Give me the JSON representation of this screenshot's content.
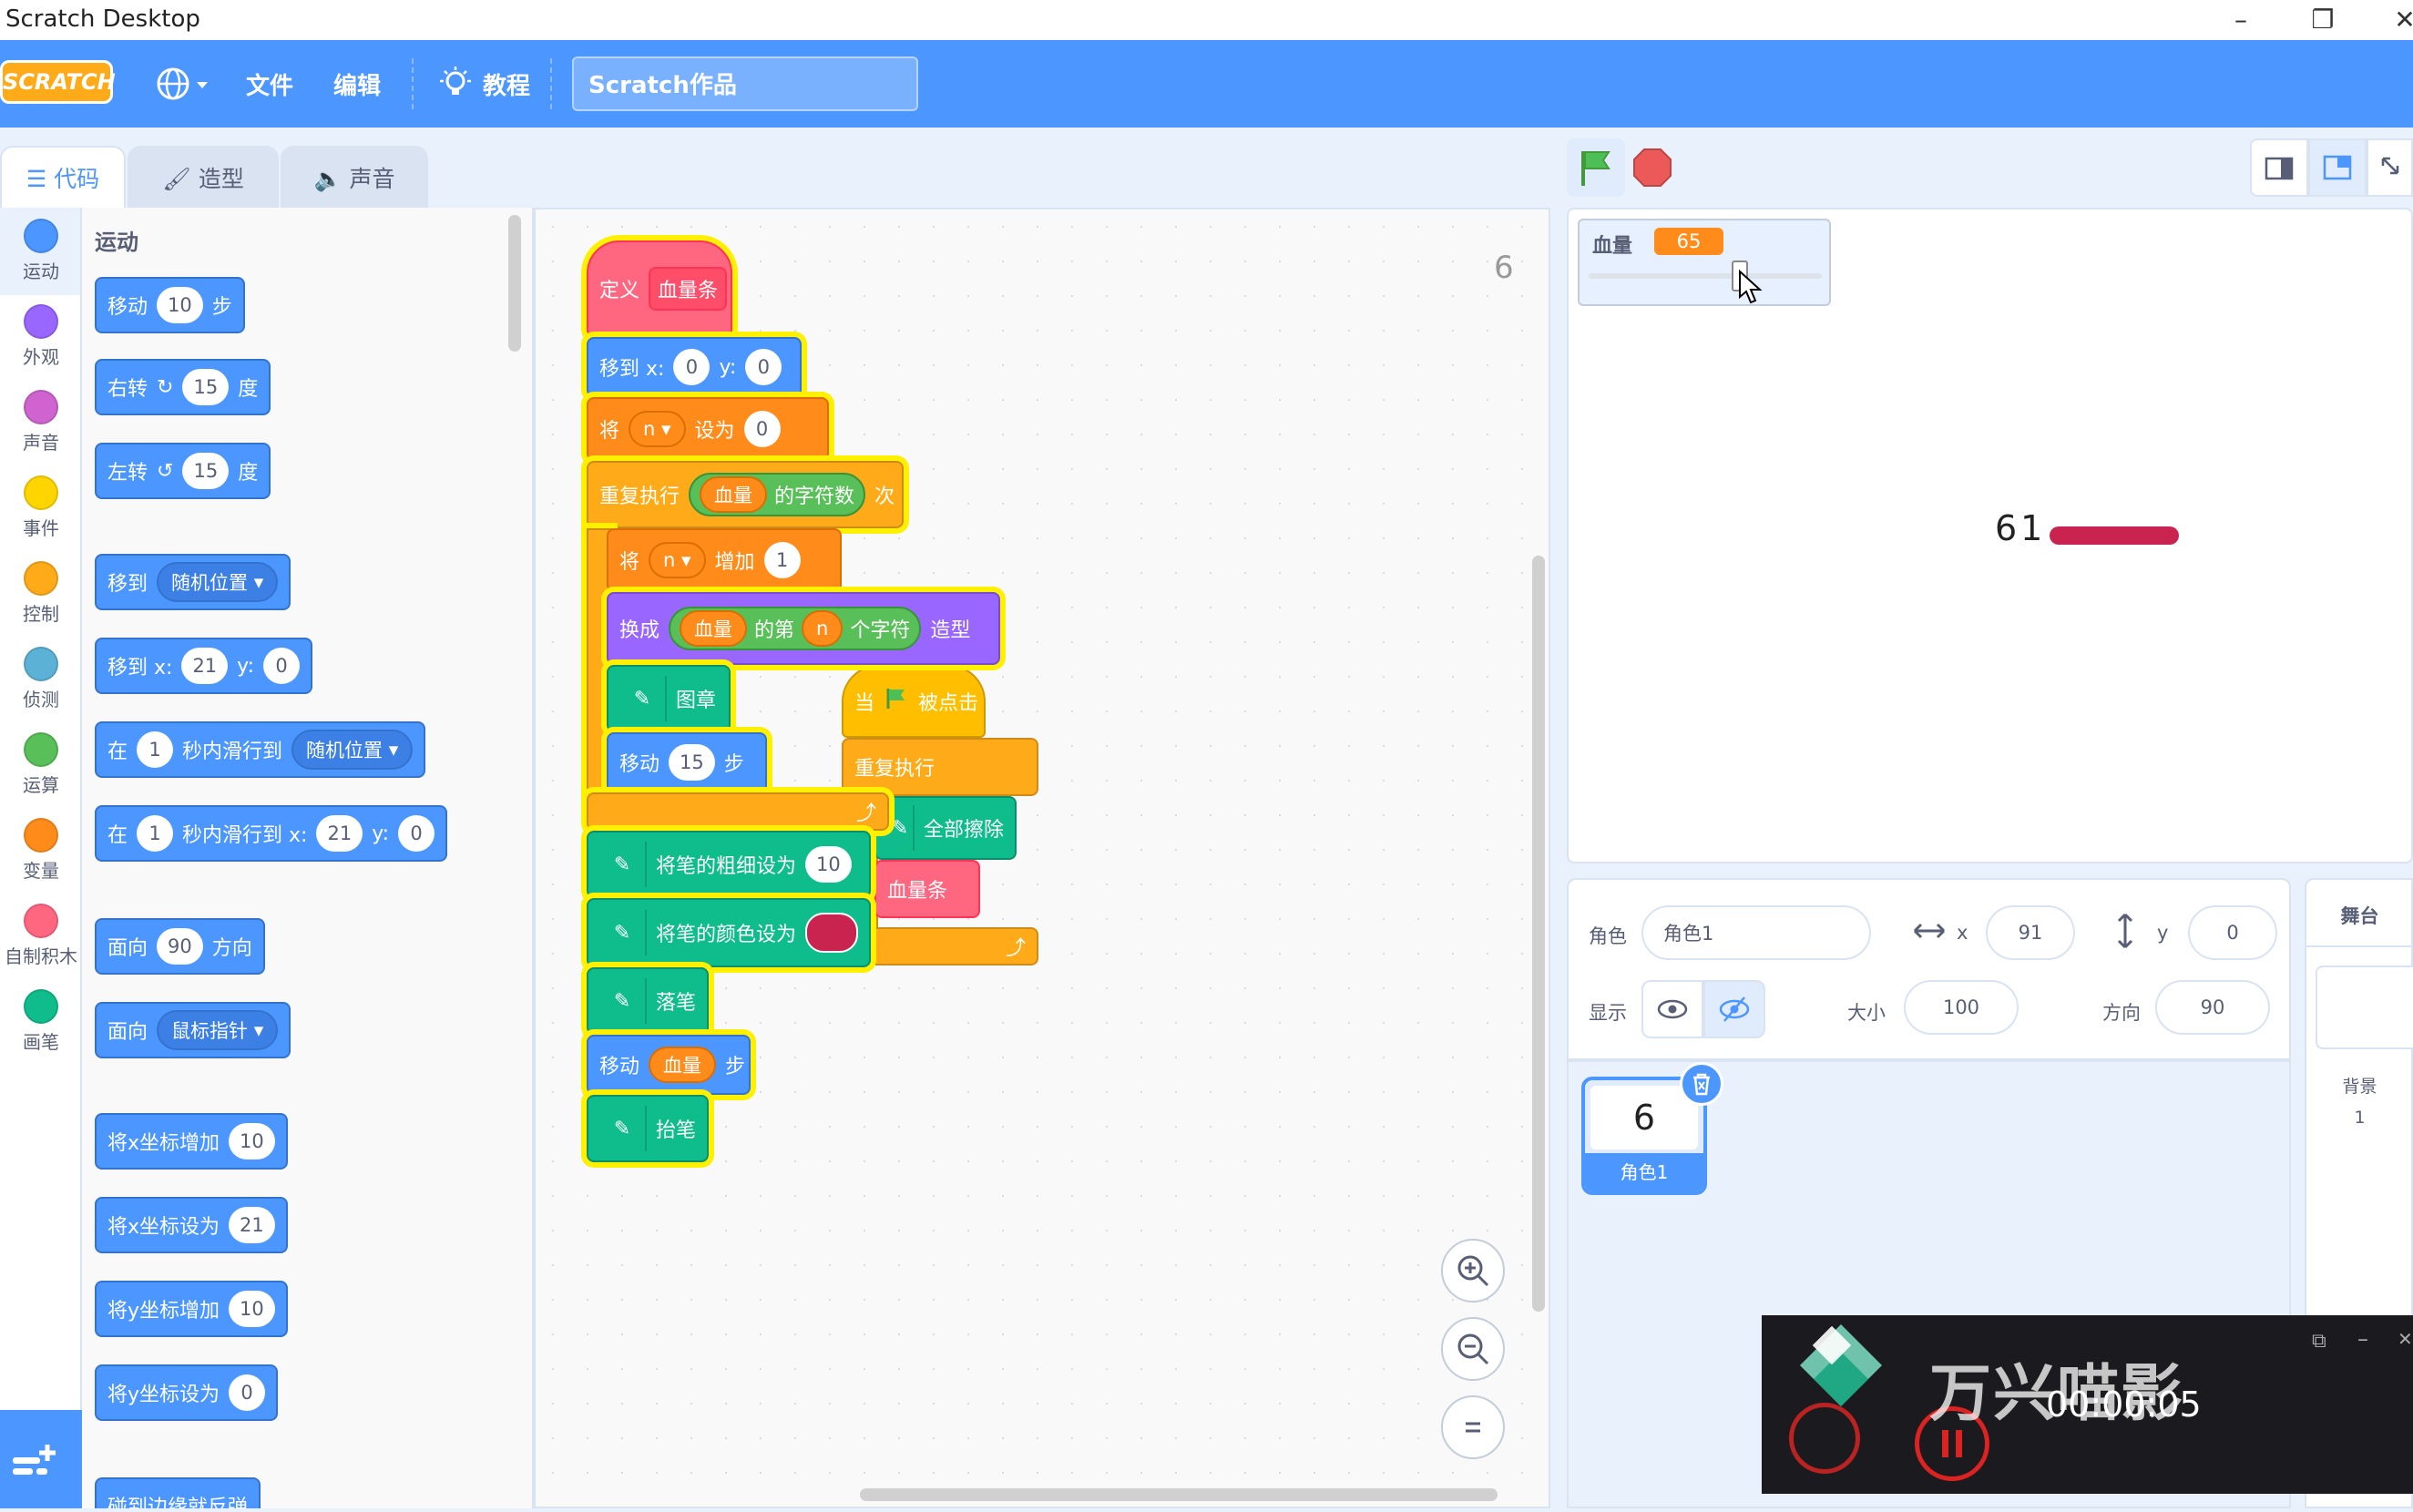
{
  "window": {
    "title": "Scratch Desktop"
  },
  "menubar": {
    "logo": "SCRATCH",
    "file": "文件",
    "edit": "编辑",
    "tutorials": "教程",
    "project_title": "Scratch作品"
  },
  "tabs": {
    "code": "代码",
    "costumes": "造型",
    "sounds": "声音"
  },
  "categories": [
    {
      "label": "运动",
      "color": "#4c97ff"
    },
    {
      "label": "外观",
      "color": "#9966ff"
    },
    {
      "label": "声音",
      "color": "#cf63cf"
    },
    {
      "label": "事件",
      "color": "#ffd500"
    },
    {
      "label": "控制",
      "color": "#ffab19"
    },
    {
      "label": "侦测",
      "color": "#5cb1d6"
    },
    {
      "label": "运算",
      "color": "#59c059"
    },
    {
      "label": "变量",
      "color": "#ff8c1a"
    },
    {
      "label": "自制积木",
      "color": "#ff6680"
    },
    {
      "label": "画笔",
      "color": "#0fbd8c"
    }
  ],
  "palette": {
    "heading": "运动",
    "move": {
      "a": "移动",
      "v": "10",
      "b": "步"
    },
    "turn_right": {
      "a": "右转",
      "v": "15",
      "b": "度"
    },
    "turn_left": {
      "a": "左转",
      "v": "15",
      "b": "度"
    },
    "goto": {
      "a": "移到",
      "d": "随机位置"
    },
    "goto_xy": {
      "a": "移到 x:",
      "x": "21",
      "y_lbl": "y:",
      "y": "0"
    },
    "glide": {
      "a": "在",
      "v": "1",
      "b": "秒内滑行到",
      "d": "随机位置"
    },
    "glide_xy": {
      "a": "在",
      "v": "1",
      "b": "秒内滑行到 x:",
      "x": "21",
      "y_lbl": "y:",
      "y": "0"
    },
    "point_dir": {
      "a": "面向",
      "v": "90",
      "b": "方向"
    },
    "point_towards": {
      "a": "面向",
      "d": "鼠标指针"
    },
    "change_x": {
      "a": "将x坐标增加",
      "v": "10"
    },
    "set_x": {
      "a": "将x坐标设为",
      "v": "21"
    },
    "change_y": {
      "a": "将y坐标增加",
      "v": "10"
    },
    "set_y": {
      "a": "将y坐标设为",
      "v": "0"
    },
    "bounce": "碰到边缘就反弹"
  },
  "script": {
    "define": "定义",
    "define_name": "血量条",
    "goto_a": "移到 x:",
    "goto_x": "0",
    "goto_y_lbl": "y:",
    "goto_y": "0",
    "set_a": "将",
    "set_var": "n",
    "set_b": "设为",
    "set_v": "0",
    "repeat_a": "重复执行",
    "repeat_var": "血量",
    "repeat_op": "的字符数",
    "repeat_b": "次",
    "change_a": "将",
    "change_var": "n",
    "change_b": "增加",
    "change_v": "1",
    "switch_a": "换成",
    "switch_var": "血量",
    "switch_op1": "的第",
    "switch_n": "n",
    "switch_op2": "个字符",
    "switch_b": "造型",
    "stamp": "图章",
    "move_a": "移动",
    "move_v": "15",
    "move_b": "步",
    "pen_size": "将笔的粗细设为",
    "pen_size_v": "10",
    "pen_color": "将笔的颜色设为",
    "pen_down": "落笔",
    "move2_a": "移动",
    "move2_var": "血量",
    "move2_b": "步",
    "pen_up": "抬笔"
  },
  "script2": {
    "when": "当",
    "clicked": "被点击",
    "forever": "重复执行",
    "clear": "全部擦除",
    "call": "血量条"
  },
  "code_counter": "6",
  "stage": {
    "monitor_label": "血量",
    "monitor_value": "65",
    "monitor_slider_fraction": 0.65,
    "stage_text": "61"
  },
  "sprite_info": {
    "sprite_label": "角色",
    "sprite_name": "角色1",
    "x_label": "x",
    "x": "91",
    "y_label": "y",
    "y": "0",
    "show_label": "显示",
    "size_label": "大小",
    "size": "100",
    "direction_label": "方向",
    "direction": "90"
  },
  "sprite_list": [
    {
      "glyph": "6",
      "name": "角色1"
    }
  ],
  "stage_pane": {
    "title": "舞台",
    "backdrops_label": "背景",
    "backdrops_count": "1"
  },
  "recorder": {
    "brand": "万兴喵影",
    "time": "00:00:05"
  }
}
